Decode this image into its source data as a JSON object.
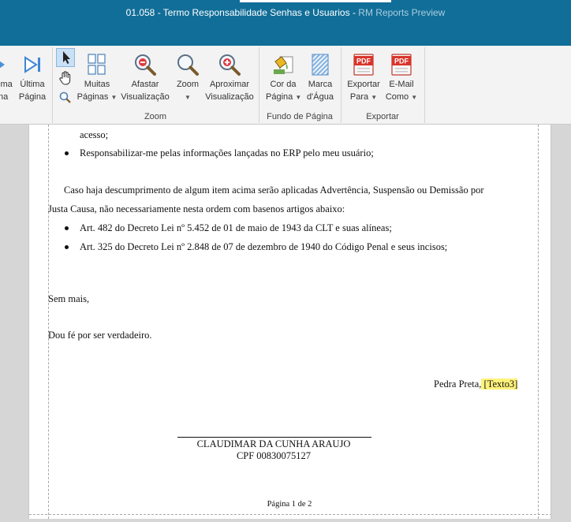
{
  "window": {
    "title": "01.058 - Termo Responsabilidade Senhas e Usuarios",
    "app_name": "RM Reports Preview"
  },
  "ribbon": {
    "nav": {
      "prev_label_1": "ima",
      "prev_label_2": "na",
      "last_label_1": "Última",
      "last_label_2": "Página"
    },
    "zoom_group": {
      "label": "Zoom",
      "many_pages_1": "Muitas",
      "many_pages_2": "Páginas",
      "zoom_out_1": "Afastar",
      "zoom_out_2": "Visualização",
      "zoom_1": "Zoom",
      "zoom_in_1": "Aproximar",
      "zoom_in_2": "Visualização"
    },
    "background_group": {
      "label": "Fundo de Página",
      "page_color_1": "Cor da",
      "page_color_2": "Página",
      "watermark_1": "Marca",
      "watermark_2": "d'Água"
    },
    "export_group": {
      "label": "Exportar",
      "export_1": "Exportar",
      "export_2": "Para",
      "email_1": "E-Mail",
      "email_2": "Como",
      "pdf_badge": "PDF"
    }
  },
  "document": {
    "line_access": "acesso;",
    "bullet_erp": "Responsabilizar-me pelas informações lançadas no ERP pelo meu usuário;",
    "paragraph_1": "Caso haja descumprimento de algum item acima serão aplicadas Advertência, Suspensão ou Demissão por",
    "paragraph_2": "Justa Causa, não necessariamente nesta ordem com basenos artigos abaixo:",
    "bullet_art482": "Art. 482 do Decreto Lei nº 5.452 de 01 de maio de 1943 da CLT e suas alíneas;",
    "bullet_art325": "Art. 325 do Decreto Lei nº 2.848 de 07 de dezembro de 1940 do Código Penal e seus incisos;",
    "sem_mais": "Sem mais,",
    "dou_fe": "Dou fé por ser verdadeiro.",
    "place": "Pedra Preta,",
    "date_placeholder": "[Texto3]",
    "signer_name": "CLAUDIMAR DA CUNHA ARAUJO",
    "signer_cpf": "CPF 00830075127",
    "page_number": "Página 1 de 2"
  }
}
